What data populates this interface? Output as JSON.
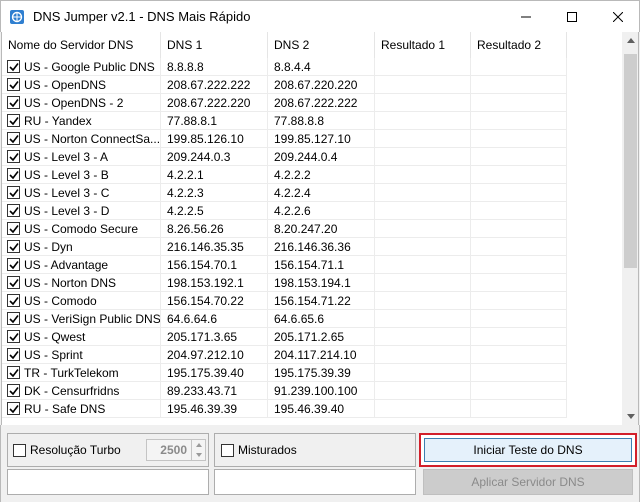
{
  "window": {
    "title": "DNS Jumper v2.1 - DNS Mais Rápido"
  },
  "columns": [
    "Nome do Servidor DNS",
    "DNS 1",
    "DNS 2",
    "Resultado 1",
    "Resultado 2"
  ],
  "rows": [
    {
      "name": "US - Google Public DNS",
      "dns1": "8.8.8.8",
      "dns2": "8.8.4.4"
    },
    {
      "name": "US - OpenDNS",
      "dns1": "208.67.222.222",
      "dns2": "208.67.220.220"
    },
    {
      "name": "US - OpenDNS - 2",
      "dns1": "208.67.222.220",
      "dns2": "208.67.222.222"
    },
    {
      "name": "RU - Yandex",
      "dns1": "77.88.8.1",
      "dns2": "77.88.8.8"
    },
    {
      "name": "US - Norton ConnectSa...",
      "dns1": "199.85.126.10",
      "dns2": "199.85.127.10"
    },
    {
      "name": "US - Level 3 - A",
      "dns1": "209.244.0.3",
      "dns2": "209.244.0.4"
    },
    {
      "name": "US - Level 3 - B",
      "dns1": "4.2.2.1",
      "dns2": "4.2.2.2"
    },
    {
      "name": "US - Level 3 - C",
      "dns1": "4.2.2.3",
      "dns2": "4.2.2.4"
    },
    {
      "name": "US - Level 3 - D",
      "dns1": "4.2.2.5",
      "dns2": "4.2.2.6"
    },
    {
      "name": "US - Comodo Secure",
      "dns1": "8.26.56.26",
      "dns2": "8.20.247.20"
    },
    {
      "name": "US - Dyn",
      "dns1": "216.146.35.35",
      "dns2": "216.146.36.36"
    },
    {
      "name": "US - Advantage",
      "dns1": "156.154.70.1",
      "dns2": "156.154.71.1"
    },
    {
      "name": "US - Norton DNS",
      "dns1": "198.153.192.1",
      "dns2": "198.153.194.1"
    },
    {
      "name": "US - Comodo",
      "dns1": "156.154.70.22",
      "dns2": "156.154.71.22"
    },
    {
      "name": "US - VeriSign Public DNS",
      "dns1": "64.6.64.6",
      "dns2": "64.6.65.6"
    },
    {
      "name": "US - Qwest",
      "dns1": "205.171.3.65",
      "dns2": "205.171.2.65"
    },
    {
      "name": "US - Sprint",
      "dns1": "204.97.212.10",
      "dns2": "204.117.214.10"
    },
    {
      "name": "TR - TurkTelekom",
      "dns1": "195.175.39.40",
      "dns2": "195.175.39.39"
    },
    {
      "name": "DK - Censurfridns",
      "dns1": "89.233.43.71",
      "dns2": "91.239.100.100"
    },
    {
      "name": "RU - Safe DNS",
      "dns1": "195.46.39.39",
      "dns2": "195.46.39.40"
    }
  ],
  "controls": {
    "turbo_label": "Resolução Turbo",
    "turbo_value": "2500",
    "mixed_label": "Misturados",
    "start_test_label": "Iniciar Teste do DNS",
    "apply_label": "Aplicar Servidor DNS"
  },
  "colors": {
    "highlight_border": "#d21f2a",
    "button_focus": "#3c7fb1"
  }
}
